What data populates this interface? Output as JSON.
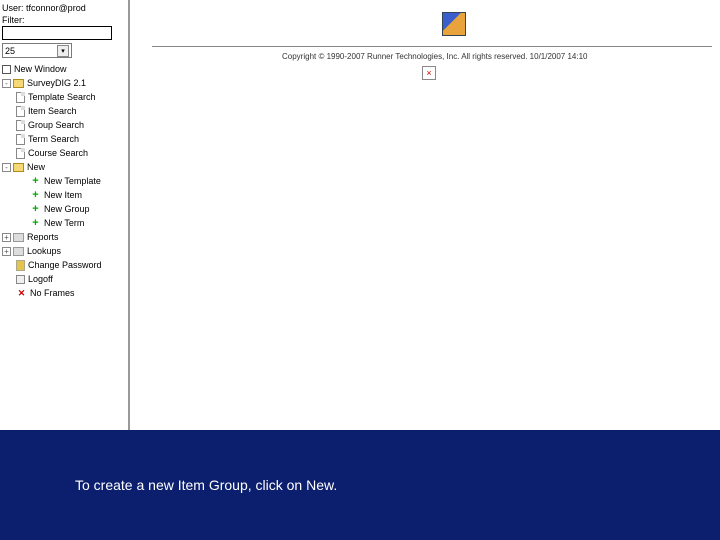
{
  "sidebar": {
    "user_prefix": "User:",
    "user_name": "tfconnor@prod",
    "filter_label": "Filter:",
    "combo_value": "25",
    "tree": {
      "new_window": "New Window",
      "root": "SurveyDIG 2.1",
      "search": {
        "template": "Template Search",
        "item": "Item Search",
        "group": "Group Search",
        "term": "Term Search",
        "course": "Course Search"
      },
      "new": {
        "label": "New",
        "template": "New Template",
        "item": "New Item",
        "group": "New Group",
        "term": "New Term"
      },
      "reports": "Reports",
      "lookups": "Lookups",
      "change_pw": "Change Password",
      "logoff": "Logoff",
      "no_frames": "No Frames"
    }
  },
  "content": {
    "copyright": "Copyright © 1990-2007 Runner Technologies, Inc. All rights reserved. 10/1/2007 14:10",
    "broken_img": "×"
  },
  "caption": "To create a new Item Group, click on New."
}
